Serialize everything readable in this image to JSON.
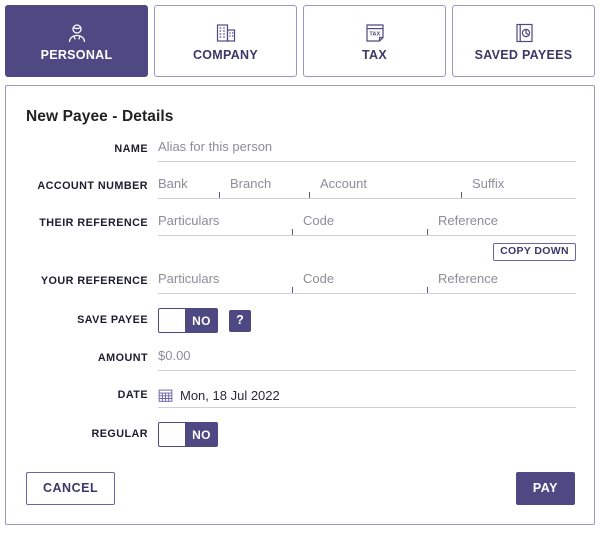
{
  "theme": {
    "accent": "#4e4883",
    "accent_text": "#3b3768",
    "border": "#9b97bd",
    "field_underline": "#cfcfd8",
    "placeholder": "#8d8d97"
  },
  "tabs": [
    {
      "label": "PERSONAL",
      "icon": "person-icon",
      "active": true
    },
    {
      "label": "COMPANY",
      "icon": "building-icon",
      "active": false
    },
    {
      "label": "TAX",
      "icon": "tax-icon",
      "active": false
    },
    {
      "label": "SAVED PAYEES",
      "icon": "address-book-icon",
      "active": false
    }
  ],
  "card": {
    "title": "New Payee - Details",
    "fields": {
      "name": {
        "label": "NAME",
        "placeholder": "Alias for this person",
        "value": ""
      },
      "account_number": {
        "label": "ACCOUNT NUMBER",
        "segments": [
          {
            "placeholder": "Bank",
            "value": ""
          },
          {
            "placeholder": "Branch",
            "value": ""
          },
          {
            "placeholder": "Account",
            "value": ""
          },
          {
            "placeholder": "Suffix",
            "value": ""
          }
        ]
      },
      "their_reference": {
        "label": "THEIR REFERENCE",
        "segments": [
          {
            "placeholder": "Particulars",
            "value": ""
          },
          {
            "placeholder": "Code",
            "value": ""
          },
          {
            "placeholder": "Reference",
            "value": ""
          }
        ]
      },
      "copy_down": {
        "label": "COPY DOWN"
      },
      "your_reference": {
        "label": "YOUR REFERENCE",
        "segments": [
          {
            "placeholder": "Particulars",
            "value": ""
          },
          {
            "placeholder": "Code",
            "value": ""
          },
          {
            "placeholder": "Reference",
            "value": ""
          }
        ]
      },
      "save_payee": {
        "label": "SAVE PAYEE",
        "toggle_value": "NO",
        "help_label": "?"
      },
      "amount": {
        "label": "AMOUNT",
        "placeholder": "$0.00",
        "value": ""
      },
      "date": {
        "label": "DATE",
        "value": "Mon, 18 Jul 2022",
        "icon": "calendar-icon"
      },
      "regular": {
        "label": "REGULAR",
        "toggle_value": "NO"
      }
    },
    "footer": {
      "cancel_label": "CANCEL",
      "pay_label": "PAY"
    }
  }
}
